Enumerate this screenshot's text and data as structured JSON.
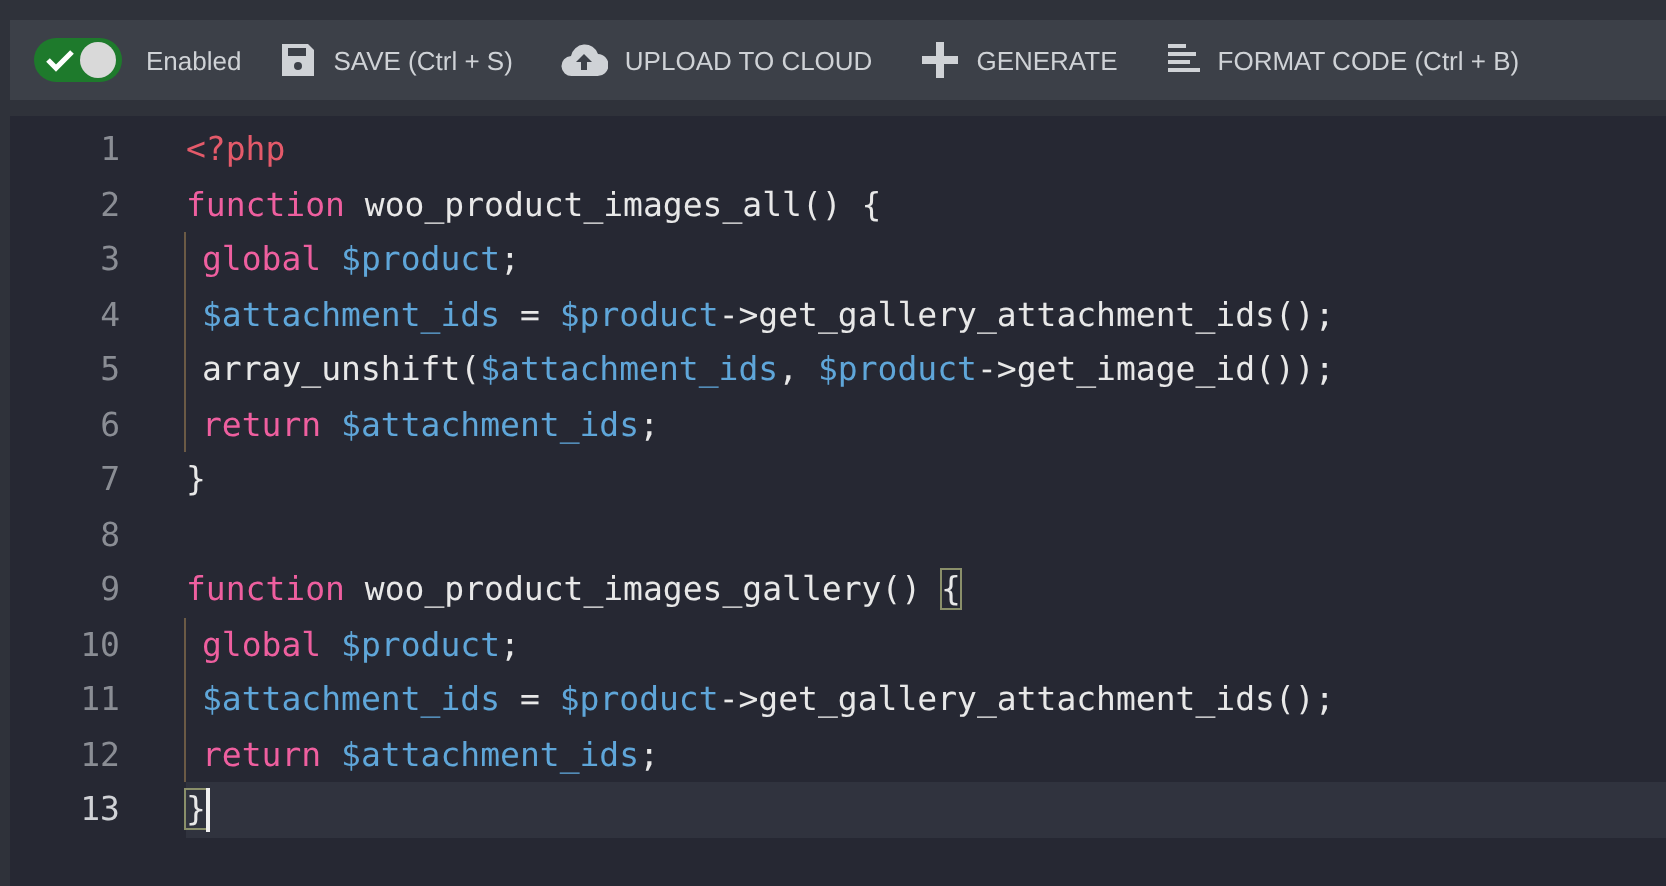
{
  "toolbar": {
    "toggle": {
      "label": "Enabled",
      "on": true
    },
    "buttons": [
      {
        "kind": "save",
        "label": "SAVE (Ctrl + S)"
      },
      {
        "kind": "upload",
        "label": "UPLOAD TO CLOUD"
      },
      {
        "kind": "generate",
        "label": "GENERATE"
      },
      {
        "kind": "format",
        "label": "FORMAT CODE (Ctrl + B)"
      }
    ]
  },
  "editor": {
    "lines": [
      {
        "number": "1",
        "selected": false,
        "indented": false,
        "tokens": [
          {
            "kind": "tag",
            "text": "<?php"
          }
        ]
      },
      {
        "number": "2",
        "selected": false,
        "indented": false,
        "tokens": [
          {
            "kind": "keyword",
            "text": "function"
          },
          {
            "kind": "plain",
            "text": " woo_product_images_all() {"
          }
        ]
      },
      {
        "number": "3",
        "selected": false,
        "indented": true,
        "tokens": [
          {
            "kind": "keyword",
            "text": "global "
          },
          {
            "kind": "variable",
            "text": "$product"
          },
          {
            "kind": "plain",
            "text": ";"
          }
        ]
      },
      {
        "number": "4",
        "selected": false,
        "indented": true,
        "tokens": [
          {
            "kind": "variable",
            "text": "$attachment_ids"
          },
          {
            "kind": "plain",
            "text": " = "
          },
          {
            "kind": "variable",
            "text": "$product"
          },
          {
            "kind": "plain",
            "text": "->get_gallery_attachment_ids();"
          }
        ]
      },
      {
        "number": "5",
        "selected": false,
        "indented": true,
        "tokens": [
          {
            "kind": "plain",
            "text": "array_unshift("
          },
          {
            "kind": "variable",
            "text": "$attachment_ids"
          },
          {
            "kind": "plain",
            "text": ", "
          },
          {
            "kind": "variable",
            "text": "$product"
          },
          {
            "kind": "plain",
            "text": "->get_image_id());"
          }
        ]
      },
      {
        "number": "6",
        "selected": false,
        "indented": true,
        "tokens": [
          {
            "kind": "keyword",
            "text": "return "
          },
          {
            "kind": "variable",
            "text": "$attachment_ids"
          },
          {
            "kind": "plain",
            "text": ";"
          }
        ]
      },
      {
        "number": "7",
        "selected": false,
        "indented": false,
        "tokens": [
          {
            "kind": "plain",
            "text": "}"
          }
        ]
      },
      {
        "number": "8",
        "selected": false
      },
      {
        "number": "9",
        "selected": false,
        "indented": false,
        "tokens": [
          {
            "kind": "keyword",
            "text": "function"
          },
          {
            "kind": "plain",
            "text": " woo_product_images_gallery() "
          },
          {
            "kind": "bracket-match",
            "text": "{"
          }
        ]
      },
      {
        "number": "10",
        "selected": false,
        "indented": true,
        "tokens": [
          {
            "kind": "keyword",
            "text": "global "
          },
          {
            "kind": "variable",
            "text": "$product"
          },
          {
            "kind": "plain",
            "text": ";"
          }
        ]
      },
      {
        "number": "11",
        "selected": false,
        "indented": true,
        "tokens": [
          {
            "kind": "variable",
            "text": "$attachment_ids"
          },
          {
            "kind": "plain",
            "text": " = "
          },
          {
            "kind": "variable",
            "text": "$product"
          },
          {
            "kind": "plain",
            "text": "->get_gallery_attachment_ids();"
          }
        ]
      },
      {
        "number": "12",
        "selected": false,
        "indented": true,
        "tokens": [
          {
            "kind": "keyword",
            "text": "return "
          },
          {
            "kind": "variable",
            "text": "$attachment_ids"
          },
          {
            "kind": "plain",
            "text": ";"
          }
        ]
      },
      {
        "number": "13",
        "selected": true,
        "indented": false,
        "tokens": [
          {
            "kind": "bracket-match",
            "text": "}"
          }
        ]
      }
    ]
  }
}
